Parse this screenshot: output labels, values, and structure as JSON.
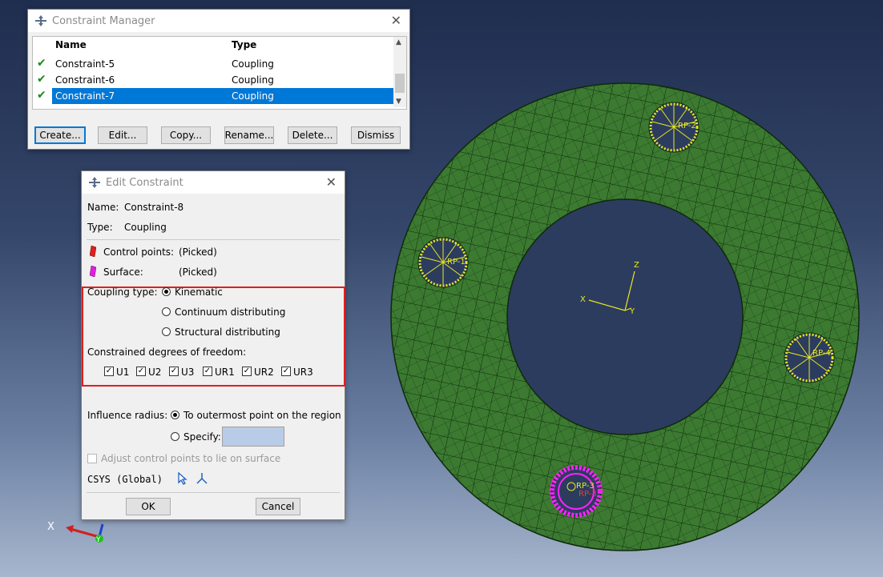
{
  "constraint_manager": {
    "title": "Constraint Manager",
    "columns": [
      "Name",
      "Type"
    ],
    "rows": [
      {
        "name": "Constraint-5",
        "type": "Coupling",
        "selected": false
      },
      {
        "name": "Constraint-6",
        "type": "Coupling",
        "selected": false
      },
      {
        "name": "Constraint-7",
        "type": "Coupling",
        "selected": true
      }
    ],
    "buttons": {
      "create": "Create...",
      "edit": "Edit...",
      "copy": "Copy...",
      "rename": "Rename...",
      "delete": "Delete...",
      "dismiss": "Dismiss"
    }
  },
  "edit_constraint": {
    "title": "Edit Constraint",
    "name_label": "Name:",
    "name_value": "Constraint-8",
    "type_label": "Type:",
    "type_value": "Coupling",
    "control_points_label": "Control points:",
    "control_points_value": "(Picked)",
    "surface_label": "Surface:",
    "surface_value": "(Picked)",
    "coupling_type_label": "Coupling type:",
    "coupling_options": [
      "Kinematic",
      "Continuum distributing",
      "Structural distributing"
    ],
    "coupling_selected": "Kinematic",
    "dof_label": "Constrained degrees of freedom:",
    "dof": [
      {
        "label": "U1",
        "checked": true
      },
      {
        "label": "U2",
        "checked": true
      },
      {
        "label": "U3",
        "checked": true
      },
      {
        "label": "UR1",
        "checked": true
      },
      {
        "label": "UR2",
        "checked": true
      },
      {
        "label": "UR3",
        "checked": true
      }
    ],
    "influence_label": "Influence radius:",
    "influence_opt1": "To outermost point on the region",
    "influence_opt2": "Specify:",
    "specify_value": "",
    "adjust_label": "Adjust control points to lie on surface",
    "csys_label": "CSYS (Global)",
    "ok": "OK",
    "cancel": "Cancel"
  },
  "viewport": {
    "triad_labels": {
      "x": "X",
      "y": "Y",
      "z": "Z"
    },
    "model_triad_labels": {
      "x": "X",
      "y": "Y",
      "z": "Z"
    },
    "rp_labels": [
      "RP-2",
      "RP-1",
      "RP-4",
      "RP-3"
    ],
    "colors": {
      "mesh": "#3c7a32",
      "coupling_kinematic": "#e8e820",
      "coupling_picked": "#ff20ff",
      "background_top": "#1f2d4e",
      "background_bottom": "#a7b6cd"
    }
  }
}
